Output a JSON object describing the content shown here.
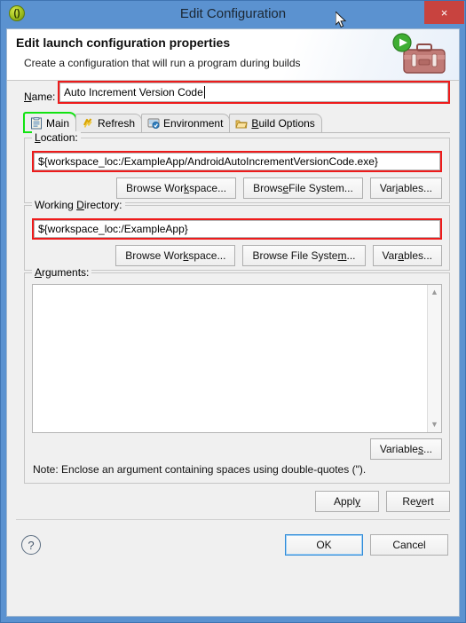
{
  "window": {
    "title": "Edit Configuration",
    "app_icon": "parentheses-icon",
    "close_label": "×"
  },
  "banner": {
    "title": "Edit launch configuration properties",
    "subtitle": "Create a configuration that will run a program during builds",
    "art": "toolbox-run-icon"
  },
  "name": {
    "label": "Name:",
    "label_mnemonic": "N",
    "value": "Auto Increment Version Code",
    "placeholder": ""
  },
  "tabs": [
    {
      "label": "Main",
      "icon": "document-icon",
      "active": true,
      "highlighted": true
    },
    {
      "label": "Refresh",
      "icon": "refresh-icon",
      "active": false,
      "highlighted": false
    },
    {
      "label": "Environment",
      "icon": "environment-icon",
      "active": false,
      "highlighted": false
    },
    {
      "label": "Build Options",
      "icon": "folder-icon",
      "active": false,
      "highlighted": false
    }
  ],
  "location": {
    "legend": "Location:",
    "value": "${workspace_loc:/ExampleApp/AndroidAutoIncrementVersionCode.exe}",
    "highlighted": true,
    "buttons": [
      {
        "label": "Browse Workspace..."
      },
      {
        "label": "Browse File System..."
      },
      {
        "label": "Variables..."
      }
    ]
  },
  "working_directory": {
    "legend": "Working Directory:",
    "value": "${workspace_loc:/ExampleApp}",
    "highlighted": true,
    "buttons": [
      {
        "label": "Browse Workspace..."
      },
      {
        "label": "Browse File System..."
      },
      {
        "label": "Variables..."
      }
    ]
  },
  "arguments": {
    "legend": "Arguments:",
    "value": "",
    "variables_button": "Variables...",
    "note": "Note: Enclose an argument containing spaces using double-quotes (\")."
  },
  "action_buttons": {
    "apply": "Apply",
    "revert": "Revert"
  },
  "bottom": {
    "help_icon": "help-icon",
    "ok": "OK",
    "cancel": "Cancel"
  },
  "colors": {
    "titlebar": "#5b92d0",
    "close": "#c8433f",
    "highlight_red": "#ee1b1b",
    "highlight_green": "#12e312",
    "dialog_bg": "#f0f0f0",
    "focus_blue": "#2e8ad8"
  }
}
